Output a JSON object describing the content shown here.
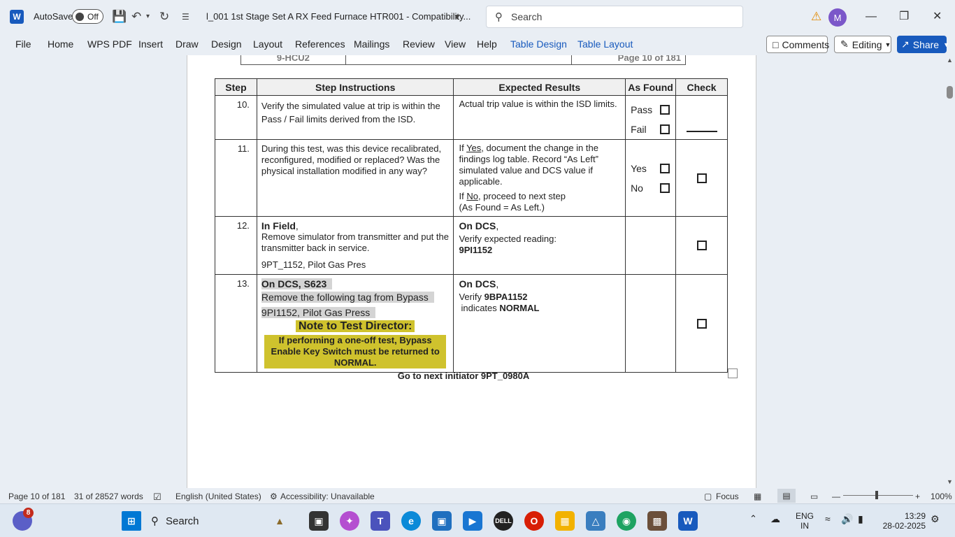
{
  "titlebar": {
    "app_logo": "W",
    "autosave_label": "AutoSave",
    "autosave_state": "Off",
    "doc_title": "l_001 1st Stage Set A RX Feed Furnace HTR001  -  Compatibility...",
    "search_placeholder": "Search",
    "avatar_initial": "M"
  },
  "ribbon": {
    "tabs": [
      "File",
      "Home",
      "WPS PDF",
      "Insert",
      "Draw",
      "Design",
      "Layout",
      "References",
      "Mailings",
      "Review",
      "View",
      "Help"
    ],
    "context_tabs": [
      "Table Design",
      "Table Layout"
    ],
    "comments_label": "Comments",
    "editing_label": "Editing",
    "share_label": "Share"
  },
  "page_header": {
    "cell_left": "9-HCU2",
    "cell_right": "Page 10 of 181"
  },
  "table": {
    "headers": [
      "Step",
      "Step Instructions",
      "Expected Results",
      "As Found",
      "Check"
    ],
    "row10": {
      "step": "10.",
      "instruction": "Verify the simulated value at trip is within the Pass / Fail limits derived from the ISD.",
      "expected": "Actual trip value is within the ISD limits.",
      "as_found_1": "Pass",
      "as_found_2": "Fail"
    },
    "row11": {
      "step": "11.",
      "instruction": "During this test, was this device recalibrated, reconfigured, modified or replaced? Was the physical installation modified in any way?",
      "exp_if": "If ",
      "exp_yes": "Yes",
      "exp_yes_rest": ", document the change in the findings log table. Record “As Left” simulated value and DCS value if applicable.",
      "exp_no": "No",
      "exp_no_rest": ", proceed to next step",
      "exp_no_line2": "(As Found = As Left.)",
      "as_found_1": "Yes",
      "as_found_2": "No"
    },
    "row12": {
      "step": "12.",
      "instr_bold": "In Field",
      "instr_comma": ",",
      "instr_line": "Remove simulator from transmitter and put the transmitter back in service.",
      "instr_tag": "9PT_1152, Pilot Gas Pres",
      "exp_bold": "On DCS",
      "exp_comma": ",",
      "exp_line": "Verify expected reading:",
      "exp_tag": "9PI1152"
    },
    "row13": {
      "step": "13.",
      "instr_bold": "On DCS, S623",
      "instr_line": "Remove the following tag from Bypass",
      "instr_tag": "9PI1152, Pilot Gas Press",
      "note_title": "Note to Test Director:",
      "note_body": "If performing a one-off test, Bypass Enable Key Switch must be returned to NORMAL.",
      "exp_bold": "On DCS",
      "exp_comma": ",",
      "exp_verify": "Verify ",
      "exp_tag": "9BPA1152",
      "exp_ind": " indicates ",
      "exp_state": "NORMAL"
    }
  },
  "goto_text": "Go to next initiator 9PT_0980A",
  "statusbar": {
    "page": "Page 10 of 181",
    "words": "31 of 28527 words",
    "language": "English (United States)",
    "accessibility": "Accessibility: Unavailable",
    "focus": "Focus",
    "zoom": "100%"
  },
  "taskbar": {
    "search_label": "Search",
    "badge_count": "8",
    "lang_1": "ENG",
    "lang_2": "IN",
    "time": "13:29",
    "date": "28-02-2025"
  }
}
